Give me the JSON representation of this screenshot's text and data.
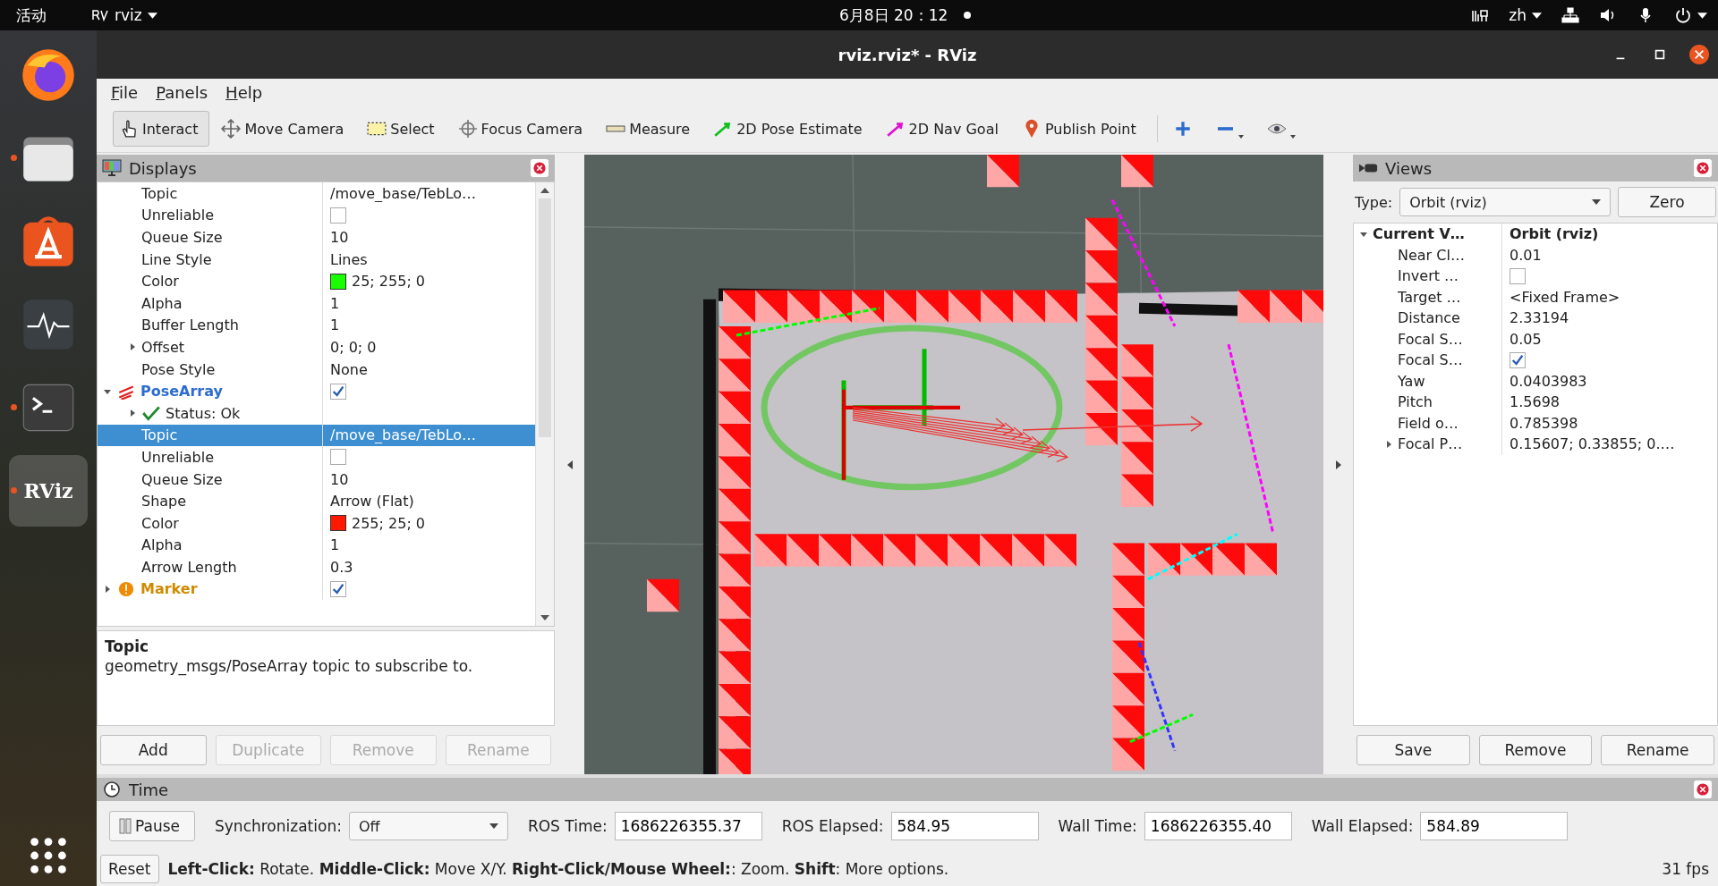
{
  "topbar": {
    "activities": "活动",
    "app": "rviz",
    "clock": "6月8日 20：12",
    "language": "zh"
  },
  "dock": [
    {
      "kind": "browser",
      "running": false,
      "selected": false
    },
    {
      "kind": "files",
      "running": true,
      "selected": false
    },
    {
      "kind": "store",
      "running": false,
      "selected": false
    },
    {
      "kind": "monitor",
      "running": false,
      "selected": false
    },
    {
      "kind": "terminal",
      "running": true,
      "selected": false
    },
    {
      "kind": "app",
      "label": "RViz",
      "running": true,
      "selected": true
    }
  ],
  "window": {
    "title": "rviz.rviz* - RViz"
  },
  "menu": [
    "File",
    "Panels",
    "Help"
  ],
  "toolbar": [
    {
      "kind": "interact",
      "label": "Interact",
      "selected": true
    },
    {
      "kind": "move_camera",
      "label": "Move Camera",
      "selected": false
    },
    {
      "kind": "select",
      "label": "Select",
      "selected": false
    },
    {
      "kind": "focus_camera",
      "label": "Focus Camera",
      "selected": false
    },
    {
      "kind": "measure",
      "label": "Measure",
      "selected": false
    },
    {
      "kind": "pose_estimate",
      "label": "2D Pose Estimate",
      "selected": false
    },
    {
      "kind": "nav_goal",
      "label": "2D Nav Goal",
      "selected": false
    },
    {
      "kind": "publish_point",
      "label": "Publish Point",
      "selected": false
    },
    {
      "kind": "plus",
      "selected": false
    },
    {
      "kind": "minus",
      "selected": false
    },
    {
      "kind": "eye",
      "selected": false
    }
  ],
  "displays": {
    "title": "Displays",
    "rows": [
      {
        "kind": "text",
        "label": "Topic",
        "value": "/move_base/TebLo…",
        "selected": false
      },
      {
        "kind": "checkbox",
        "label": "Unreliable",
        "checked": false,
        "selected": false
      },
      {
        "kind": "text",
        "label": "Queue Size",
        "value": "10",
        "selected": false
      },
      {
        "kind": "text",
        "label": "Line Style",
        "value": "Lines",
        "selected": false
      },
      {
        "kind": "color",
        "label": "Color",
        "value": "25; 255; 0",
        "color": "#19ff00",
        "selected": false
      },
      {
        "kind": "text",
        "label": "Alpha",
        "value": "1",
        "selected": false
      },
      {
        "kind": "text",
        "label": "Buffer Length",
        "value": "1",
        "selected": false
      },
      {
        "kind": "text",
        "label": "Offset",
        "value": "0; 0; 0",
        "expanded": false,
        "selected": false
      },
      {
        "kind": "text",
        "label": "Pose Style",
        "value": "None",
        "selected": false
      },
      {
        "kind": "display",
        "label": "PoseArray",
        "warning": false,
        "checked": true,
        "expanded": true,
        "selected": false,
        "children": [
          {
            "kind": "status",
            "label": "Status: Ok",
            "expanded": false,
            "selected": false
          },
          {
            "kind": "text",
            "label": "Topic",
            "value": "/move_base/TebLo…",
            "selected": true
          },
          {
            "kind": "checkbox",
            "label": "Unreliable",
            "checked": false,
            "selected": false
          },
          {
            "kind": "text",
            "label": "Queue Size",
            "value": "10",
            "selected": false
          },
          {
            "kind": "text",
            "label": "Shape",
            "value": "Arrow (Flat)",
            "selected": false
          },
          {
            "kind": "color",
            "label": "Color",
            "value": "255; 25; 0",
            "color": "#ff1900",
            "selected": false
          },
          {
            "kind": "text",
            "label": "Alpha",
            "value": "1",
            "selected": false
          },
          {
            "kind": "text",
            "label": "Arrow Length",
            "value": "0.3",
            "selected": false
          }
        ]
      },
      {
        "kind": "display",
        "label": "Marker",
        "warning": true,
        "checked": true,
        "expanded": false,
        "selected": false
      }
    ],
    "description": {
      "title": "Topic",
      "text": "geometry_msgs/PoseArray topic to subscribe to."
    },
    "buttons": [
      {
        "label": "Add",
        "disabled": false
      },
      {
        "label": "Duplicate",
        "disabled": true
      },
      {
        "label": "Remove",
        "disabled": true
      },
      {
        "label": "Rename",
        "disabled": true
      }
    ]
  },
  "views": {
    "title": "Views",
    "type_label": "Type:",
    "type": "Orbit (rviz)",
    "zero": "Zero",
    "rows": [
      {
        "kind": "group",
        "label": "Current V…",
        "value": "Orbit (rviz)",
        "expanded": true,
        "children": [
          {
            "kind": "text",
            "label": "Near Cl…",
            "value": "0.01"
          },
          {
            "kind": "checkbox",
            "label": "Invert …",
            "checked": false
          },
          {
            "kind": "text",
            "label": "Target …",
            "value": "<Fixed Frame>"
          },
          {
            "kind": "text",
            "label": "Distance",
            "value": "2.33194"
          },
          {
            "kind": "text",
            "label": "Focal S…",
            "value": "0.05"
          },
          {
            "kind": "checkbox",
            "label": "Focal S…",
            "checked": true
          },
          {
            "kind": "text",
            "label": "Yaw",
            "value": "0.0403983"
          },
          {
            "kind": "text",
            "label": "Pitch",
            "value": "1.5698"
          },
          {
            "kind": "text",
            "label": "Field o…",
            "value": "0.785398"
          },
          {
            "kind": "text",
            "label": "Focal P…",
            "value": "0.15607; 0.33855; 0.…",
            "expanded": false
          }
        ]
      }
    ],
    "buttons": [
      "Save",
      "Remove",
      "Rename"
    ]
  },
  "time": {
    "title": "Time",
    "pause": "Pause",
    "sync_label": "Synchronization:",
    "sync": "Off",
    "fields": [
      {
        "label": "ROS Time:",
        "value": "1686226355.37"
      },
      {
        "label": "ROS Elapsed:",
        "value": "584.95"
      },
      {
        "label": "Wall Time:",
        "value": "1686226355.40"
      },
      {
        "label": "Wall Elapsed:",
        "value": "584.89"
      }
    ]
  },
  "status": {
    "reset": "Reset",
    "hint": "**Left-Click:** Rotate. **Middle-Click:** Move X/Y. **Right-Click/Mouse Wheel:**: Zoom. **Shift**: More options.",
    "fps": "31 fps"
  }
}
